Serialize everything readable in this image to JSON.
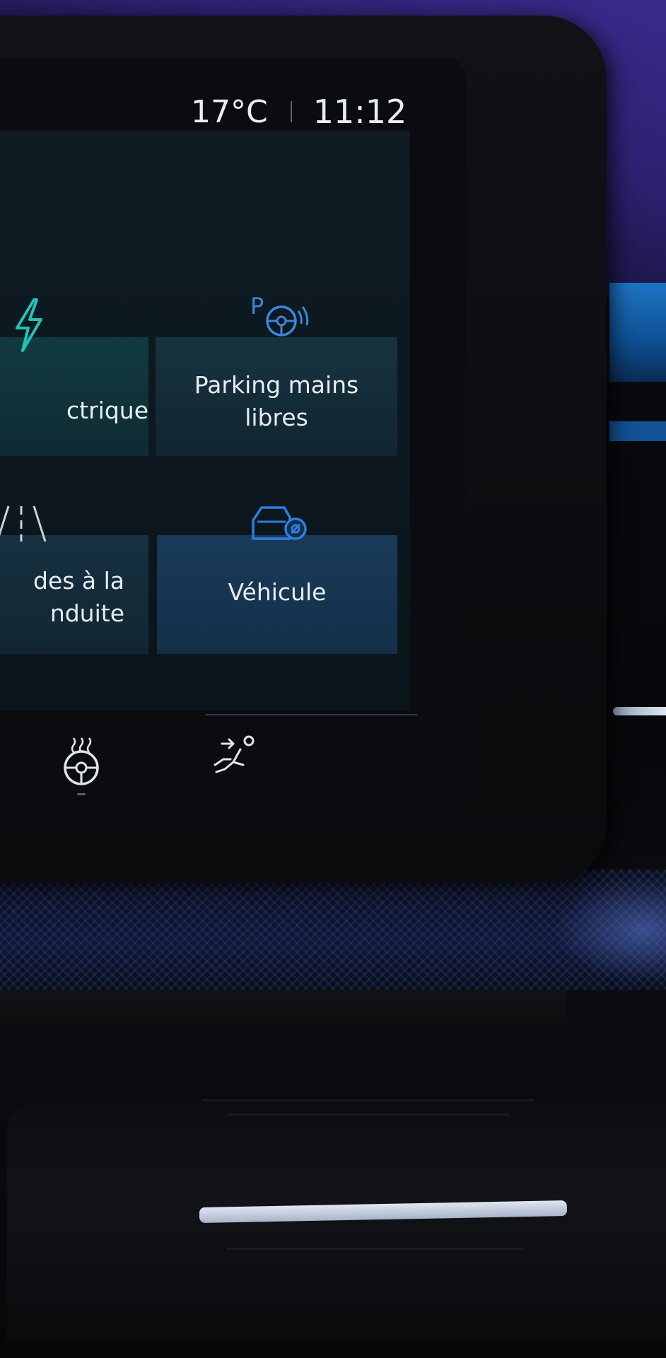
{
  "status_bar": {
    "temperature": "17°C",
    "time": "11:12"
  },
  "tiles": [
    {
      "id": "electric",
      "label_lines": [
        "ctrique"
      ],
      "icon": "lightning-icon",
      "color": "#22c2b4"
    },
    {
      "id": "parking",
      "label_lines": [
        "Parking mains",
        "libres"
      ],
      "icon": "parking-steering-icon",
      "color": "#3c86d8"
    },
    {
      "id": "driving-assist",
      "label_lines": [
        "des à la",
        "nduite"
      ],
      "icon": "road-lanes-icon",
      "color": "#c9d1d8"
    },
    {
      "id": "vehicle",
      "label_lines": [
        "Véhicule"
      ],
      "icon": "car-gear-icon",
      "color": "#2b7ee0"
    }
  ],
  "bottom_bar": {
    "buttons": [
      {
        "id": "heated-steering-wheel",
        "icon": "heated-steering-wheel-icon"
      },
      {
        "id": "heated-seat",
        "icon": "seat-airflow-icon"
      }
    ]
  },
  "colors": {
    "accent_teal": "#22c2b4",
    "accent_blue": "#2b7ee0",
    "text": "#e7edf1"
  }
}
